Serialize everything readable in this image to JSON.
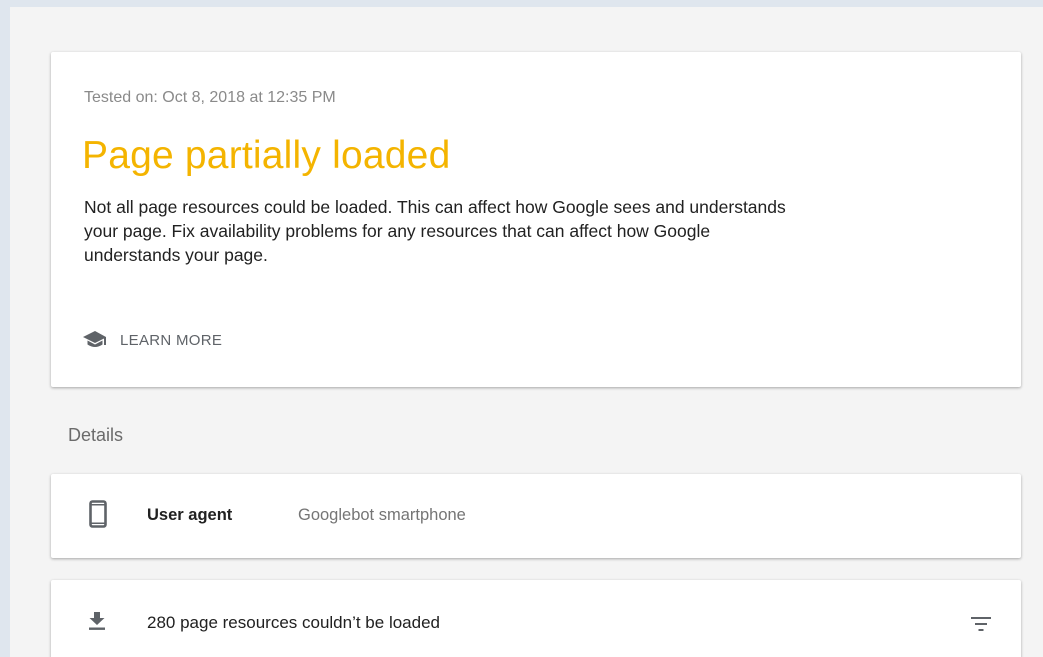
{
  "summary": {
    "tested_on": "Tested on: Oct 8, 2018 at 12:35 PM",
    "status_title": "Page partially loaded",
    "status_color": "#f4b400",
    "description": "Not all page resources could be loaded. This can affect how Google sees and understands your page. Fix availability problems for any resources that can affect how Google understands your page.",
    "learn_more": {
      "icon": "school-icon",
      "label": "LEARN MORE"
    }
  },
  "details": {
    "heading": "Details",
    "user_agent": {
      "icon": "smartphone-icon",
      "label": "User agent",
      "value": "Googlebot smartphone"
    },
    "resources": {
      "icon": "download-icon",
      "label": "280 page resources couldn’t be loaded",
      "filter_icon": "filter-icon"
    }
  }
}
